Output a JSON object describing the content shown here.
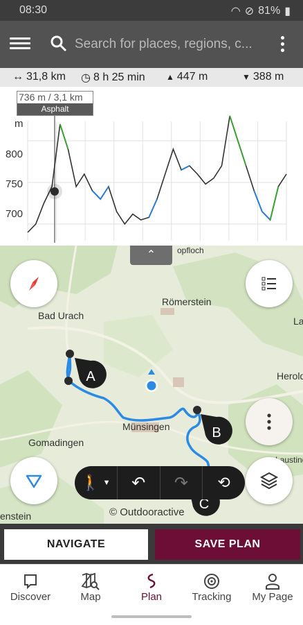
{
  "status": {
    "time": "08:30",
    "battery": "81%"
  },
  "search": {
    "placeholder": "Search for places, regions, c..."
  },
  "stats": {
    "distance": "31,8 km",
    "duration": "8 h 25 min",
    "ascent": "447 m",
    "descent": "388 m"
  },
  "profile": {
    "unit": "m",
    "y_ticks": [
      "800",
      "750",
      "700"
    ],
    "tooltip_position": "736 m / 3,1 km",
    "tooltip_surface": "Asphalt"
  },
  "chart_data": {
    "type": "line",
    "title": "",
    "xlabel": "",
    "ylabel": "m",
    "ylim": [
      680,
      840
    ],
    "x": [
      0,
      1,
      2,
      3,
      4,
      5,
      6,
      7,
      8,
      9,
      10,
      11,
      12,
      13,
      14,
      15,
      16,
      17,
      18,
      19,
      20,
      21,
      22,
      23,
      24,
      25,
      26,
      27,
      28,
      29,
      30,
      31,
      32
    ],
    "series": [
      {
        "values": [
          690,
          700,
          725,
          745,
          820,
          790,
          745,
          760,
          740,
          730,
          745,
          715,
          700,
          712,
          705,
          708,
          730,
          760,
          790,
          765,
          770,
          760,
          748,
          755,
          770,
          830,
          800,
          770,
          740,
          715,
          705,
          745,
          760
        ]
      }
    ]
  },
  "map": {
    "labels": [
      "Bad Urach",
      "Römerstein",
      "Münsingen",
      "Gomadingen",
      "Herold",
      "La",
      "Lausting",
      "enstein",
      "opfloch"
    ],
    "waypoints": [
      "A",
      "B",
      "C"
    ],
    "attribution": "© Outdooractive"
  },
  "actions": {
    "navigate": "NAVIGATE",
    "save_plan": "SAVE PLAN"
  },
  "nav": {
    "discover": "Discover",
    "map": "Map",
    "plan": "Plan",
    "tracking": "Tracking",
    "my_page": "My Page"
  },
  "colors": {
    "accent": "#6d0e36",
    "route": "#2a8ae4",
    "header": "#525252"
  }
}
